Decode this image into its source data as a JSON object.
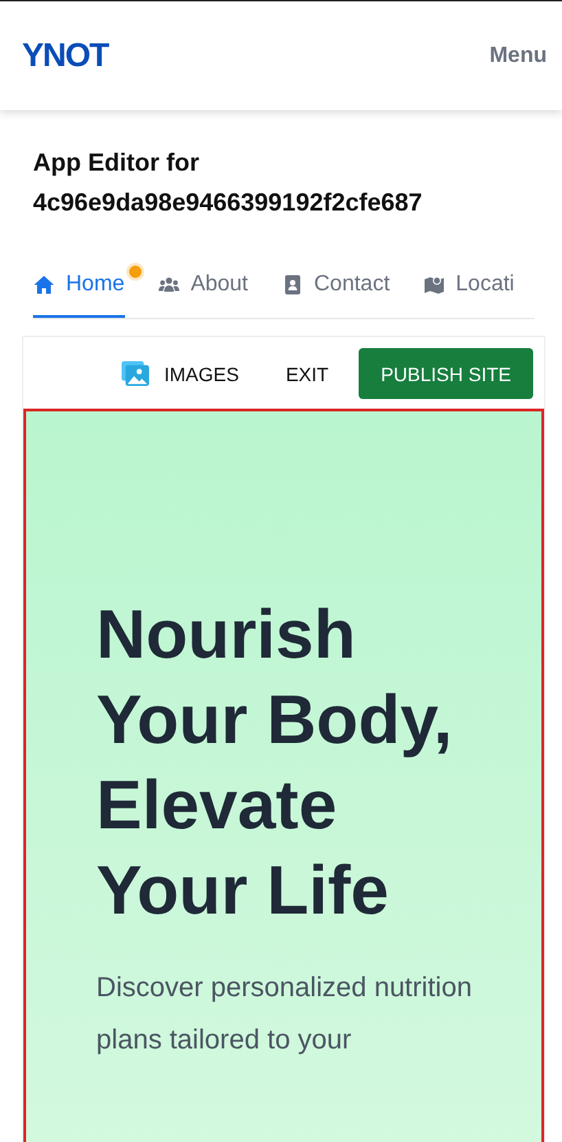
{
  "header": {
    "logo": "YNOT",
    "menu": "Menu"
  },
  "editor": {
    "title": "App Editor for",
    "id": "4c96e9da98e9466399192f2cfe687"
  },
  "tabs": [
    {
      "label": "Home",
      "kind": "home",
      "selected": true,
      "dot": true
    },
    {
      "label": "About",
      "kind": "users",
      "selected": false,
      "dot": false
    },
    {
      "label": "Contact",
      "kind": "contact",
      "selected": false,
      "dot": false
    },
    {
      "label": "Locati",
      "kind": "map",
      "selected": false,
      "dot": false
    }
  ],
  "toolbar": {
    "images": "IMAGES",
    "exit": "EXIT",
    "publish": "PUBLISH SITE"
  },
  "hero": {
    "heading": "Nourish Your Body, Elevate Your Life",
    "text": "Discover personalized nutrition plans tailored to your"
  }
}
